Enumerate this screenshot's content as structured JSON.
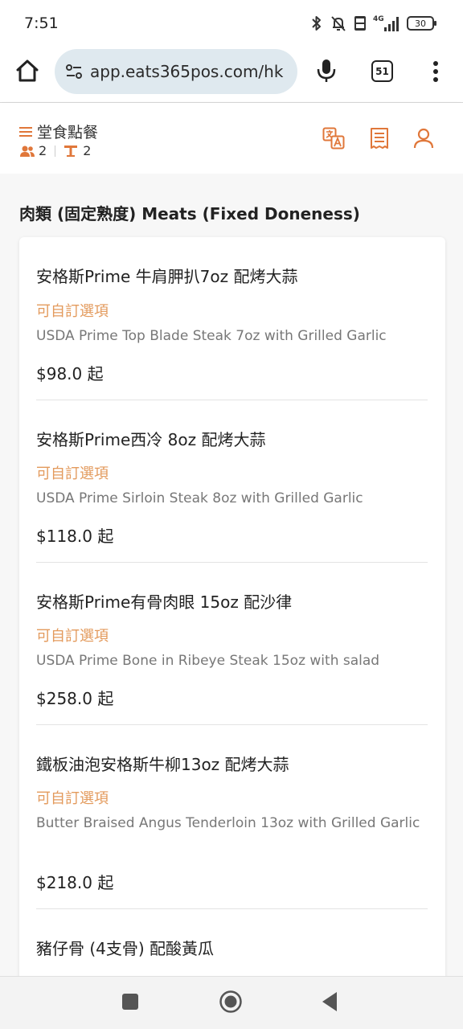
{
  "status_bar": {
    "time": "7:51",
    "battery": "30",
    "icons": [
      "bluetooth-icon",
      "bell-muted-icon",
      "volte-icon",
      "signal-4g-icon",
      "battery-icon"
    ]
  },
  "browser": {
    "url": "app.eats365pos.com/hk",
    "tab_count": "51"
  },
  "header": {
    "order_type": "堂食點餐",
    "guests": "2",
    "table": "2",
    "accent_color": "#e0773a"
  },
  "section": {
    "title": "肉類 (固定熟度) Meats (Fixed Doneness)"
  },
  "items": [
    {
      "name": "安格斯Prime 牛肩胛扒7oz 配烤大蒜",
      "option": "可自訂選項",
      "description": "USDA Prime Top Blade Steak 7oz with Grilled Garlic",
      "price": "$98.0 起"
    },
    {
      "name": "安格斯Prime西冷 8oz 配烤大蒜",
      "option": "可自訂選項",
      "description": "USDA Prime Sirloin Steak 8oz with Grilled Garlic",
      "price": "$118.0 起"
    },
    {
      "name": "安格斯Prime有骨肉眼 15oz 配沙律",
      "option": "可自訂選項",
      "description": "USDA Prime Bone in Ribeye Steak 15oz with salad",
      "price": "$258.0 起"
    },
    {
      "name": "鐵板油泡安格斯牛柳13oz 配烤大蒜",
      "option": "可自訂選項",
      "description": "Butter Braised Angus Tenderloin 13oz with Grilled Garlic",
      "price": "$218.0 起"
    },
    {
      "name": "豬仔骨 (4支骨) 配酸黃瓜"
    }
  ]
}
